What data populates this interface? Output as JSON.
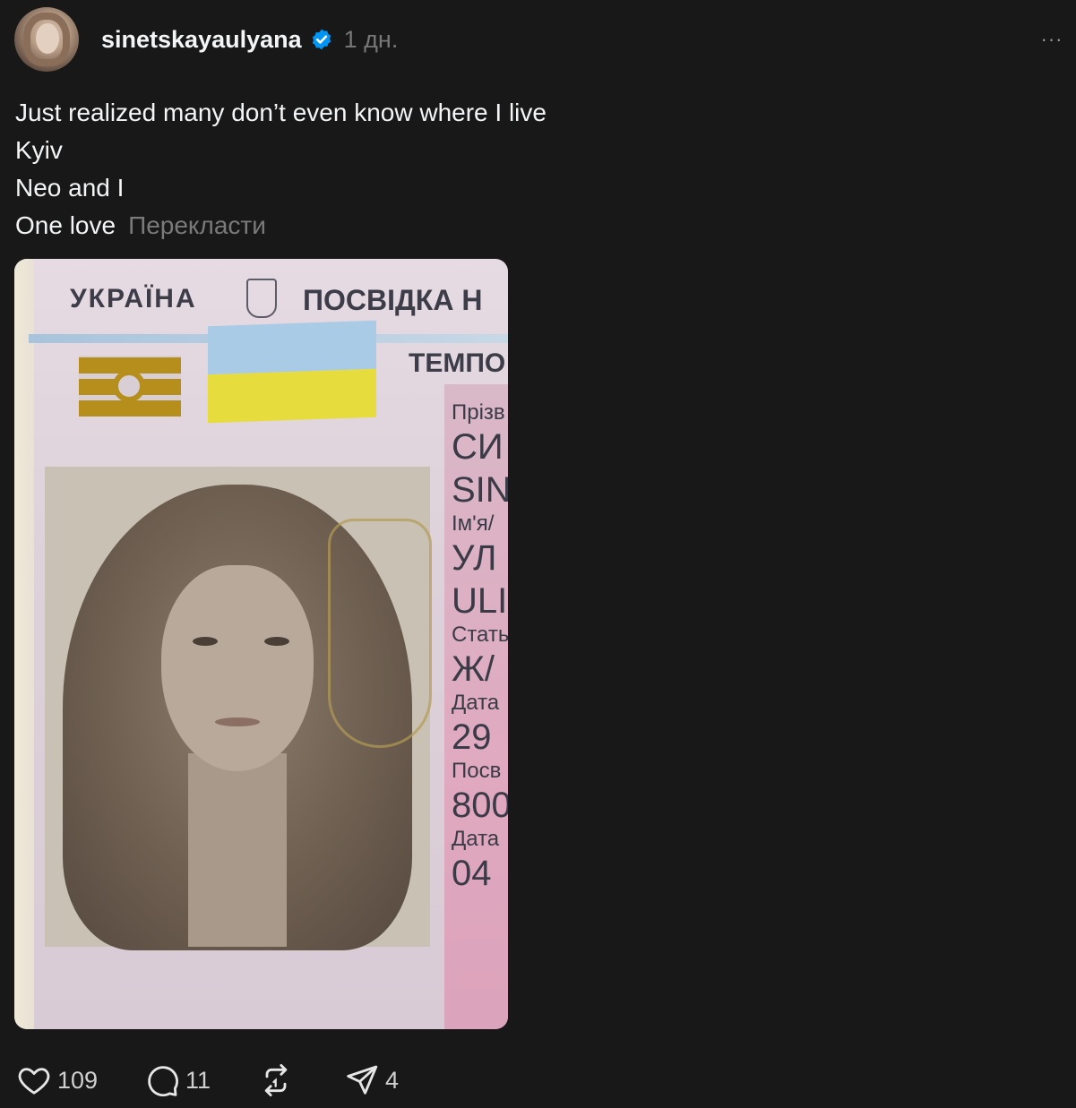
{
  "post": {
    "username": "sinetskayaulyana",
    "timestamp": "1 дн.",
    "more_label": "···",
    "text_lines": [
      "Just realized many don’t even know where I live",
      "Kyiv",
      "Neo and I",
      "One love"
    ],
    "translate_label": "Перекласти"
  },
  "id_card": {
    "country": "УКРАЇНА",
    "title": "ПОСВІДКА Н",
    "subtitle": "ТЕМПО",
    "fields": [
      {
        "label": "Прізв",
        "value_uk": "СИ",
        "value_en": "SIN"
      },
      {
        "label": "Ім'я/",
        "value_uk": "УЛ",
        "value_en": "ULI"
      },
      {
        "label": "Стать",
        "value": "Ж/"
      },
      {
        "label": "Дата",
        "value": "29"
      },
      {
        "label": "Посв",
        "value": "800"
      },
      {
        "label": "Дата",
        "value": "04"
      }
    ],
    "flag_colors": {
      "blue": "#a9cbe6",
      "yellow": "#e7dc3e"
    }
  },
  "actions": {
    "likes": "109",
    "replies": "11",
    "reposts": "",
    "shares": "4"
  },
  "icons": {
    "verified": "verified-badge-icon",
    "like": "heart-icon",
    "reply": "comment-bubble-icon",
    "repost": "repost-icon",
    "share": "send-icon",
    "more": "more-dots-icon"
  },
  "colors": {
    "background": "#181818",
    "text": "#f3f5f7",
    "muted": "#777777",
    "verified_blue": "#0095f6"
  }
}
